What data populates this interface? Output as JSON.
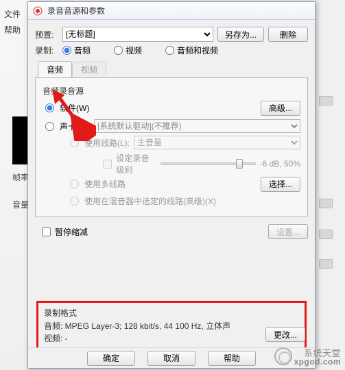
{
  "bg": {
    "menu1": "文件",
    "menu2": "帮助",
    "frame_label": "帧率",
    "volume_label": "音量"
  },
  "dialog": {
    "title": "录音音源和参数",
    "preset_label": "预置:",
    "preset_value": "[无标题]",
    "save_as": "另存为...",
    "delete": "删除",
    "record_label": "录制:",
    "rec_audio": "音频",
    "rec_video": "视频",
    "rec_av": "音频和视频"
  },
  "tabs": {
    "audio": "音频",
    "video": "视频"
  },
  "panel": {
    "src_title": "音频录音源",
    "opt_software": "软件(W)",
    "opt_soundcard": "声卡(N):",
    "soundcard_value": "[系统默认驱动](不推荐)",
    "use_line": "使用线路(L):",
    "line_value": "主音量",
    "set_rec_level": "设定录音级别",
    "slider_value": "-6 dB, 50%",
    "use_multi": "使用多线路",
    "use_mixer": "使用在混音器中选定的线路(高级)(X)",
    "advanced": "高级...",
    "select": "选择...",
    "pause_shrink": "暂停缩减",
    "settings": "设置..."
  },
  "format_box": {
    "title": "录制格式",
    "audio_line": "音频:   MPEG Layer-3; 128 kbit/s, 44 100 Hz, 立体声",
    "video_line": "视频:    -",
    "change": "更改..."
  },
  "footer": {
    "ok": "确定",
    "cancel": "取消",
    "help": "帮助"
  },
  "logo": {
    "line1": "系统天堂",
    "line2": "xpgod.com"
  }
}
